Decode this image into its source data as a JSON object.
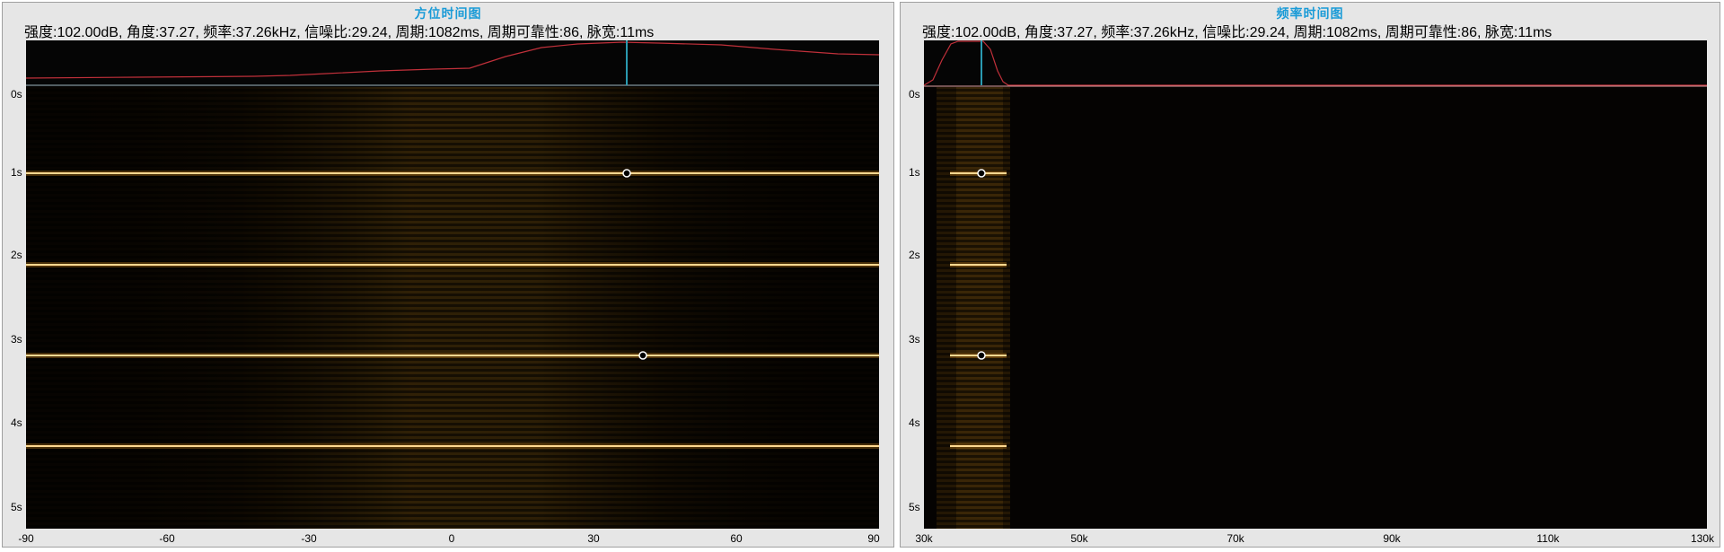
{
  "info_line": "强度:102.00dB, 角度:37.27, 频率:37.26kHz, 信噪比:29.24, 周期:1082ms, 周期可靠性:86, 脉宽:11ms",
  "left_panel": {
    "title": "方位时间图",
    "y_ticks": [
      "0s",
      "1s",
      "2s",
      "3s",
      "4s",
      "5s"
    ],
    "x_ticks": [
      "-90",
      "-60",
      "-30",
      "0",
      "30",
      "60",
      "90"
    ]
  },
  "right_panel": {
    "title": "频率时间图",
    "y_ticks": [
      "0s",
      "1s",
      "2s",
      "3s",
      "4s",
      "5s"
    ],
    "x_ticks": [
      "30k",
      "50k",
      "70k",
      "90k",
      "110k",
      "130k"
    ]
  },
  "colors": {
    "plot_bg": "#070401",
    "stripe_color": "#3c2a0a",
    "pulse_line": "#ffd890",
    "curve": "#c0303a",
    "cursor": "#2a9ab0",
    "title": "#1a9bd7"
  }
}
